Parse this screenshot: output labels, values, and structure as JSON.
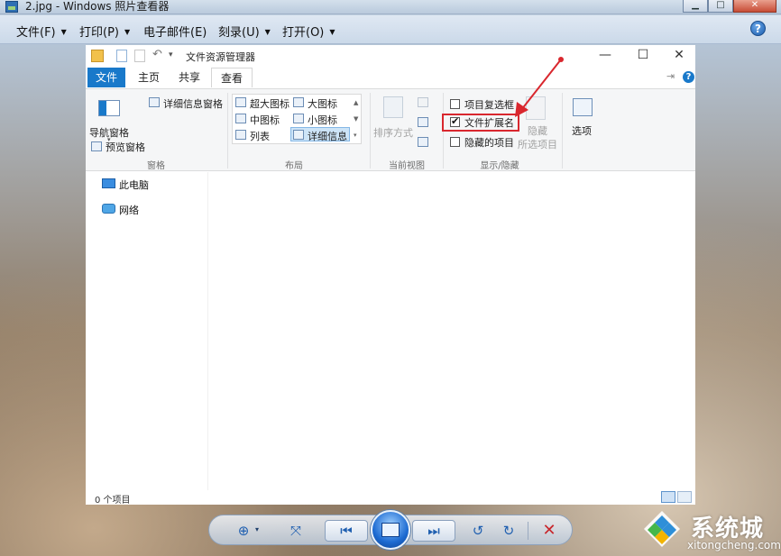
{
  "viewer": {
    "title": "2.jpg - Windows 照片查看器",
    "menu": [
      "文件(F)",
      "打印(P)",
      "电子邮件(E)",
      "刻录(U)",
      "打开(O)"
    ],
    "help": "?"
  },
  "explorer": {
    "title": "文件资源管理器",
    "tabs": {
      "file": "文件",
      "home": "主页",
      "share": "共享",
      "view": "查看"
    },
    "panes": {
      "nav_pane": "导航窗格",
      "details_pane": "详细信息窗格",
      "preview_pane": "预览窗格",
      "group": "窗格"
    },
    "layout": {
      "extra_large": "超大图标",
      "large": "大图标",
      "medium": "中图标",
      "small": "小图标",
      "list": "列表",
      "details": "详细信息",
      "group": "布局"
    },
    "current_view": {
      "sort_by": "排序方式",
      "group": "当前视图"
    },
    "show_hide": {
      "item_checkboxes": "项目复选框",
      "file_extensions": "文件扩展名",
      "hidden_items": "隐藏的项目",
      "hide_selected_1": "隐藏",
      "hide_selected_2": "所选项目",
      "group": "显示/隐藏",
      "checkboxes_checked": false,
      "extensions_checked": true,
      "hidden_checked": false
    },
    "options": "选项",
    "nav": {
      "this_pc": "此电脑",
      "network": "网络"
    },
    "status": "0 个项目"
  },
  "watermark": {
    "name": "系统城",
    "url": "xitongcheng.com"
  },
  "colors": {
    "ribbon_blue": "#1979ca",
    "highlight_red": "#d9272e"
  }
}
